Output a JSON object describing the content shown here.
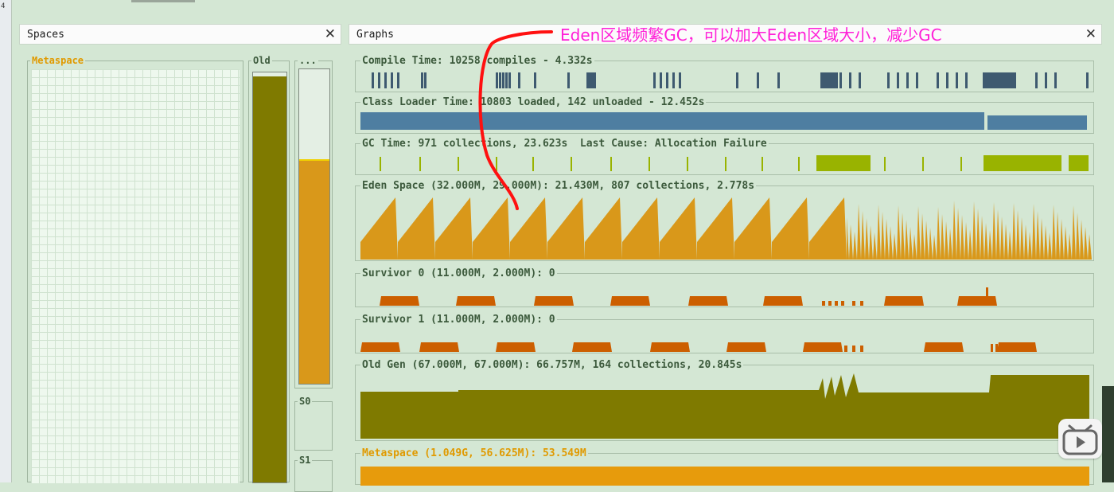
{
  "colors": {
    "background": "#d4e7d4",
    "compile": "#3e5a70",
    "class_loader": "#4e7ea1",
    "gc": "#99b300",
    "eden": "#d9981a",
    "survivor": "#cc5f00",
    "old": "#7f7a00",
    "metaspace": "#e79b0c",
    "annotation": "#ff1fd8"
  },
  "corner_text": "4",
  "spaces_panel": {
    "title": "Spaces",
    "close": "✕",
    "metaspace_label": "Metaspace",
    "old_label": "Old",
    "old_fill": 0.99,
    "eden_label": "...",
    "eden_fill": 0.71,
    "s0_label": "S0",
    "s1_label": "S1"
  },
  "graphs_panel": {
    "title": "Graphs",
    "close": "✕",
    "compile_time": "Compile Time: 10258 compiles - 4.332s",
    "class_loader_time": "Class Loader Time: 10803 loaded, 142 unloaded - 12.452s",
    "gc_time": "GC Time: 971 collections, 23.623s  Last Cause: Allocation Failure",
    "eden_space": "Eden Space (32.000M, 29.000M): 21.430M, 807 collections, 2.778s",
    "survivor0": "Survivor 0 (11.000M, 2.000M): 0",
    "survivor1": "Survivor 1 (11.000M, 2.000M): 0",
    "old_gen": "Old Gen (67.000M, 67.000M): 66.757M, 164 collections, 20.845s",
    "metaspace": "Metaspace (1.049G, 56.625M): 53.549M"
  },
  "annotation": "Eden区域频繁GC，可以加大Eden区域大小，减少GC"
}
